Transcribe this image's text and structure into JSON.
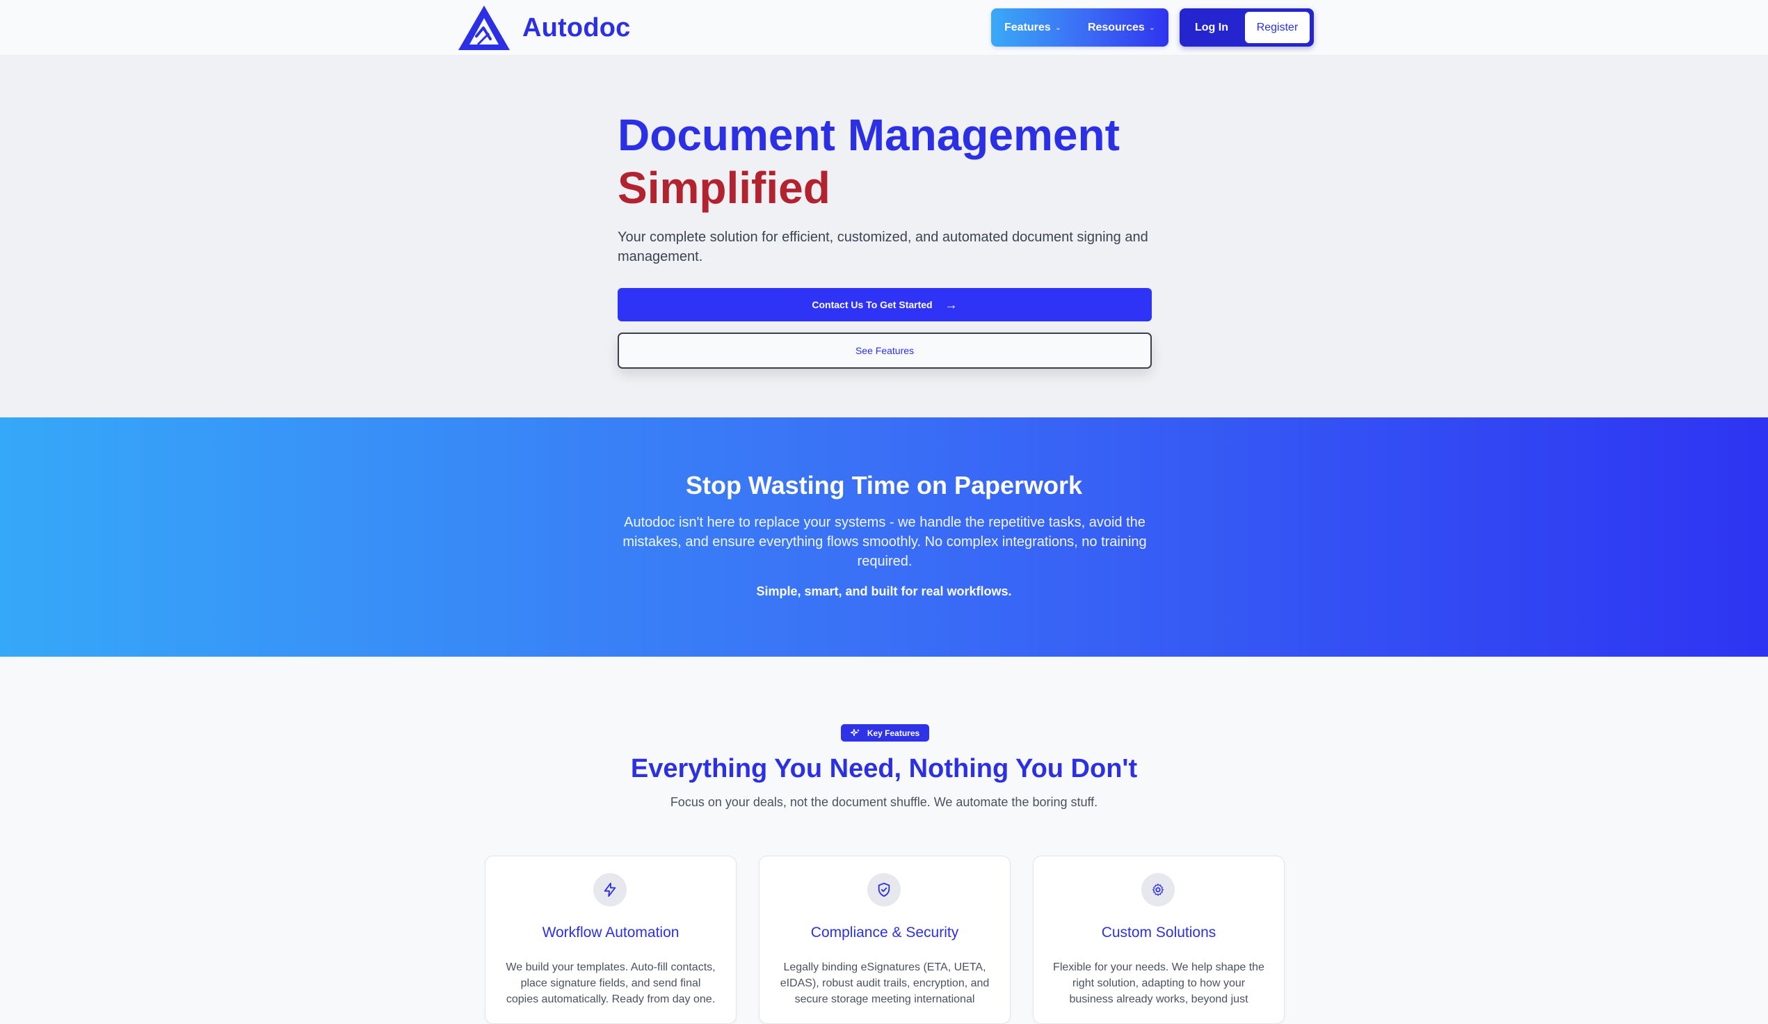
{
  "header": {
    "brand": "Autodoc",
    "nav": {
      "features_label": "Features",
      "resources_label": "Resources"
    },
    "auth": {
      "login_label": "Log In",
      "register_label": "Register"
    }
  },
  "hero": {
    "title_line1": "Document Management",
    "title_line2": "Simplified",
    "subtitle": "Your complete solution for efficient, customized, and automated document signing and management.",
    "primary_cta": "Contact Us To Get Started",
    "secondary_cta": "See Features"
  },
  "banner": {
    "title": "Stop Wasting Time on Paperwork",
    "text": "Autodoc isn't here to replace your systems - we handle the repetitive tasks, avoid the mistakes, and ensure everything flows smoothly. No complex integrations, no training required.",
    "tagline": "Simple, smart, and built for real workflows."
  },
  "features": {
    "badge": "Key Features",
    "title": "Everything You Need, Nothing You Don't",
    "subtitle": "Focus on your deals, not the document shuffle. We automate the boring stuff.",
    "cards": [
      {
        "icon": "lightning-icon",
        "title": "Workflow Automation",
        "text": "We build your templates. Auto-fill contacts, place signature fields, and send final copies automatically. Ready from day one."
      },
      {
        "icon": "shield-check-icon",
        "title": "Compliance & Security",
        "text": "Legally binding eSignatures (ETA, UETA, eIDAS), robust audit trails, encryption, and secure storage meeting international"
      },
      {
        "icon": "gear-icon",
        "title": "Custom Solutions",
        "text": "Flexible for your needs. We help shape the right solution, adapting to how your business already works, beyond just"
      }
    ]
  },
  "colors": {
    "brand_blue": "#2b2fe6",
    "accent_red": "#b3232f",
    "gradient_start": "#36a8f8",
    "gradient_end": "#2e34f2"
  }
}
